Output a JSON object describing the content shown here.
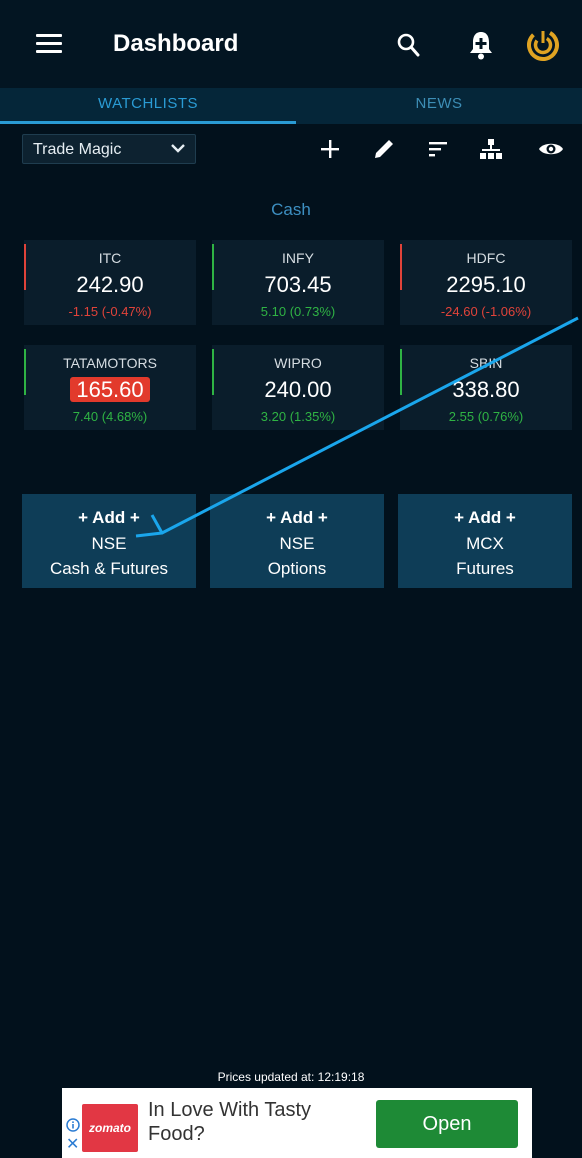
{
  "header": {
    "title": "Dashboard",
    "menu_icon": "hamburger-icon",
    "search_icon": "search-icon",
    "alert_icon": "bell-plus-icon",
    "brand_icon": "brand-logo"
  },
  "tabs": [
    {
      "label": "WATCHLISTS",
      "active": true
    },
    {
      "label": "NEWS",
      "active": false
    }
  ],
  "toolbar": {
    "watchlist_selected": "Trade Magic",
    "icons": [
      "plus-icon",
      "pencil-icon",
      "sort-icon",
      "hierarchy-icon",
      "eye-icon"
    ]
  },
  "section": {
    "title": "Cash"
  },
  "stocks": [
    {
      "symbol": "ITC",
      "price": "242.90",
      "change": "-1.15 (-0.47%)",
      "direction": "down",
      "highlight": false
    },
    {
      "symbol": "INFY",
      "price": "703.45",
      "change": "5.10 (0.73%)",
      "direction": "up",
      "highlight": false
    },
    {
      "symbol": "HDFC",
      "price": "2295.10",
      "change": "-24.60 (-1.06%)",
      "direction": "down",
      "highlight": false
    },
    {
      "symbol": "TATAMOTORS",
      "price": "165.60",
      "change": "7.40 (4.68%)",
      "direction": "up",
      "highlight": true
    },
    {
      "symbol": "WIPRO",
      "price": "240.00",
      "change": "3.20 (1.35%)",
      "direction": "up",
      "highlight": false
    },
    {
      "symbol": "SBIN",
      "price": "338.80",
      "change": "2.55 (0.76%)",
      "direction": "up",
      "highlight": false
    }
  ],
  "add_buttons": [
    {
      "line1": "+ Add +",
      "line2": "NSE",
      "line3": "Cash & Futures"
    },
    {
      "line1": "+ Add +",
      "line2": "NSE",
      "line3": "Options"
    },
    {
      "line1": "+ Add +",
      "line2": "MCX",
      "line3": "Futures"
    }
  ],
  "status": {
    "text": "Prices updated at:  12:19:18"
  },
  "ad": {
    "brand": "zomato",
    "text": "In Love With Tasty Food?",
    "button": "Open"
  },
  "colors": {
    "background": "#02111c",
    "accent": "#2a9bd4",
    "up": "#2fb344",
    "down": "#e0433a",
    "ad_button": "#1e8a36",
    "annotation_arrow": "#1aa6ec"
  }
}
